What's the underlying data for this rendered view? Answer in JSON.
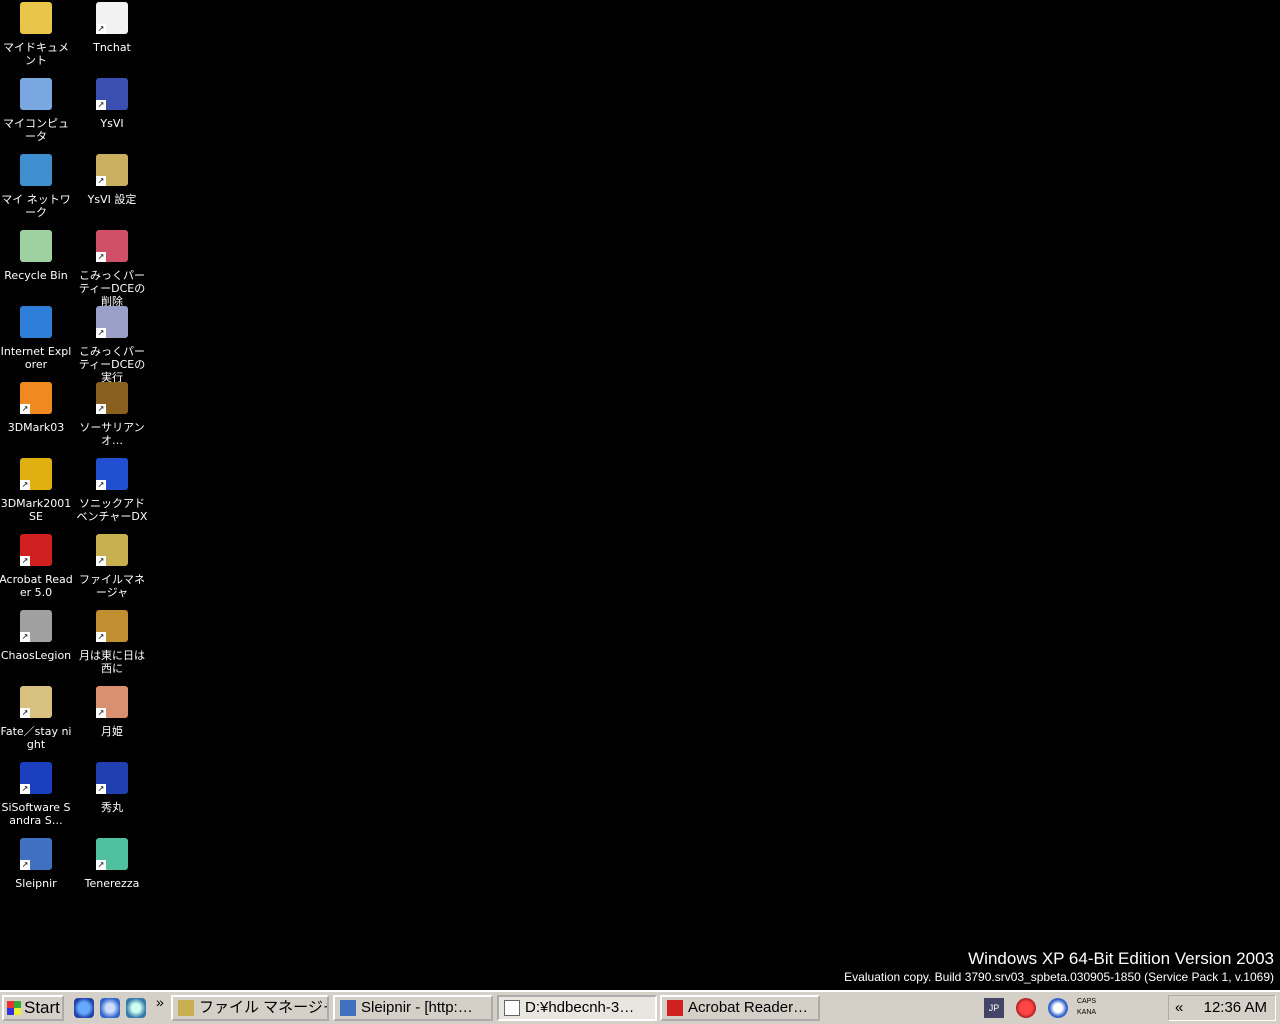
{
  "desktop": {
    "icons": [
      {
        "label": "マイドキュメント",
        "icon": "my-documents-icon",
        "color": "#e8c64a",
        "shortcut": false
      },
      {
        "label": "Tnchat",
        "icon": "chat-bubble-icon",
        "color": "#f2f2f2",
        "shortcut": true
      },
      {
        "label": "マイコンピュータ",
        "icon": "my-computer-icon",
        "color": "#7aa7e0",
        "shortcut": false
      },
      {
        "label": "YsVI",
        "icon": "ysvi-icon",
        "color": "#3a4fb0",
        "shortcut": true
      },
      {
        "label": "マイ ネットワーク",
        "icon": "my-network-icon",
        "color": "#3f8fd0",
        "shortcut": false
      },
      {
        "label": "YsVI 設定",
        "icon": "ysvi-settings-icon",
        "color": "#c8b060",
        "shortcut": true
      },
      {
        "label": "Recycle Bin",
        "icon": "recycle-bin-icon",
        "color": "#9fd09f",
        "shortcut": false
      },
      {
        "label": "こみっくパーティーDCEの削除",
        "icon": "uninstall-icon",
        "color": "#d0506a",
        "shortcut": true
      },
      {
        "label": "Internet Explorer",
        "icon": "internet-explorer-icon",
        "color": "#2f7fd8",
        "shortcut": false
      },
      {
        "label": "こみっくパーティーDCEの実行",
        "icon": "comic-party-icon",
        "color": "#9aa0c8",
        "shortcut": true
      },
      {
        "label": "3DMark03",
        "icon": "3dmark03-icon",
        "color": "#f08a20",
        "shortcut": true
      },
      {
        "label": "ソーサリアンオ…",
        "icon": "sorcerian-icon",
        "color": "#8a6020",
        "shortcut": true
      },
      {
        "label": "3DMark2001 SE",
        "icon": "3dmark2001-icon",
        "color": "#e0b010",
        "shortcut": true
      },
      {
        "label": "ソニックアドベンチャーDX",
        "icon": "sonic-dx-icon",
        "color": "#2050d0",
        "shortcut": true
      },
      {
        "label": "Acrobat Reader 5.0",
        "icon": "acrobat-reader-icon",
        "color": "#d02020",
        "shortcut": true
      },
      {
        "label": "ファイルマネージャ",
        "icon": "file-manager-icon",
        "color": "#c8b050",
        "shortcut": true
      },
      {
        "label": "ChaosLegion",
        "icon": "chaos-legion-icon",
        "color": "#a0a0a0",
        "shortcut": true
      },
      {
        "label": "月は東に日は西に",
        "icon": "tsukihigashi-icon",
        "color": "#c09030",
        "shortcut": true
      },
      {
        "label": "Fate／stay night",
        "icon": "fate-stay-night-icon",
        "color": "#d8c080",
        "shortcut": true
      },
      {
        "label": "月姫",
        "icon": "tsukihime-icon",
        "color": "#d89070",
        "shortcut": true
      },
      {
        "label": "SiSoftware Sandra S…",
        "icon": "sisoftware-sandra-icon",
        "color": "#1a40c0",
        "shortcut": true
      },
      {
        "label": "秀丸",
        "icon": "hidemaru-icon",
        "color": "#2040b0",
        "shortcut": true
      },
      {
        "label": "Sleipnir",
        "icon": "sleipnir-icon",
        "color": "#4070c0",
        "shortcut": true
      },
      {
        "label": "Tenerezza",
        "icon": "tenerezza-icon",
        "color": "#50c0a0",
        "shortcut": true
      }
    ]
  },
  "watermark": {
    "line1": "Windows XP 64-Bit Edition Version 2003",
    "line2": "Evaluation copy. Build 3790.srv03_spbeta.030905-1850 (Service Pack 1, v.1069)"
  },
  "taskbar": {
    "start_label": "Start",
    "quicklaunch": [
      "internet-explorer-icon",
      "sleipnir-icon",
      "hidemaru-icon"
    ],
    "chevron": "»",
    "tasks": [
      {
        "label": "ファイル マネージャ - …",
        "icon": "file-manager-icon",
        "active": false
      },
      {
        "label": "Sleipnir - [http:…",
        "icon": "sleipnir-icon",
        "active": false
      },
      {
        "label": "D:¥hdbecnh-3…",
        "icon": "document-icon",
        "active": true
      },
      {
        "label": "Acrobat Reader…",
        "icon": "acrobat-reader-icon",
        "active": false
      }
    ],
    "ime": "JP",
    "caps": "CAPS",
    "kana": "KANA",
    "show_hidden": "«",
    "clock": "12:36 AM"
  }
}
